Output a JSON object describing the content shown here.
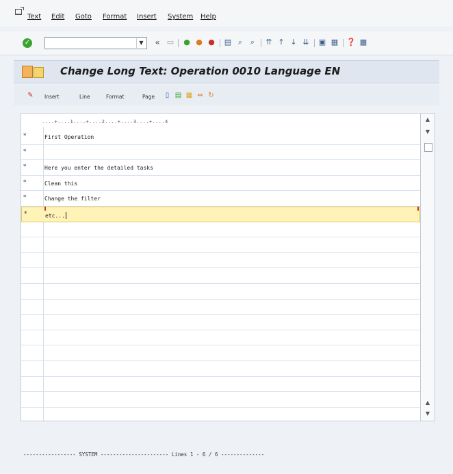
{
  "menu": {
    "items": [
      "Text",
      "Edit",
      "Goto",
      "Format",
      "Insert",
      "System",
      "Help"
    ]
  },
  "toolbar": {
    "command_value": "",
    "icons": [
      "back",
      "save",
      "back",
      "exit",
      "cancel",
      "print",
      "find",
      "find-next",
      "first-page",
      "previous-page",
      "next-page",
      "last-page",
      "create-session",
      "shortcut",
      "help",
      "settings"
    ]
  },
  "title": {
    "text": "Change Long Text: Operation 0010 Language EN"
  },
  "app_toolbar": {
    "items": [
      "Insert",
      "Line",
      "Format",
      "Page"
    ]
  },
  "editor": {
    "ruler": "....+....1....+....2....+....3....+....4",
    "rows": [
      {
        "flag": "*",
        "text": "First Operation"
      },
      {
        "flag": "*",
        "text": ""
      },
      {
        "flag": "*",
        "text": "Here you enter the detailed tasks"
      },
      {
        "flag": "*",
        "text": "Clean this"
      },
      {
        "flag": "*",
        "text": "Change the filter"
      },
      {
        "flag": "*",
        "text": "etc..."
      }
    ],
    "empty_rows": 12
  },
  "footer": {
    "status": "----------------- SYSTEM ---------------------- Lines 1 - 6 / 6 --------------"
  },
  "colors": {
    "current_line": "#fff3b8",
    "title_bg": "#dfe6ef",
    "enter_button": "#3aa32f"
  }
}
